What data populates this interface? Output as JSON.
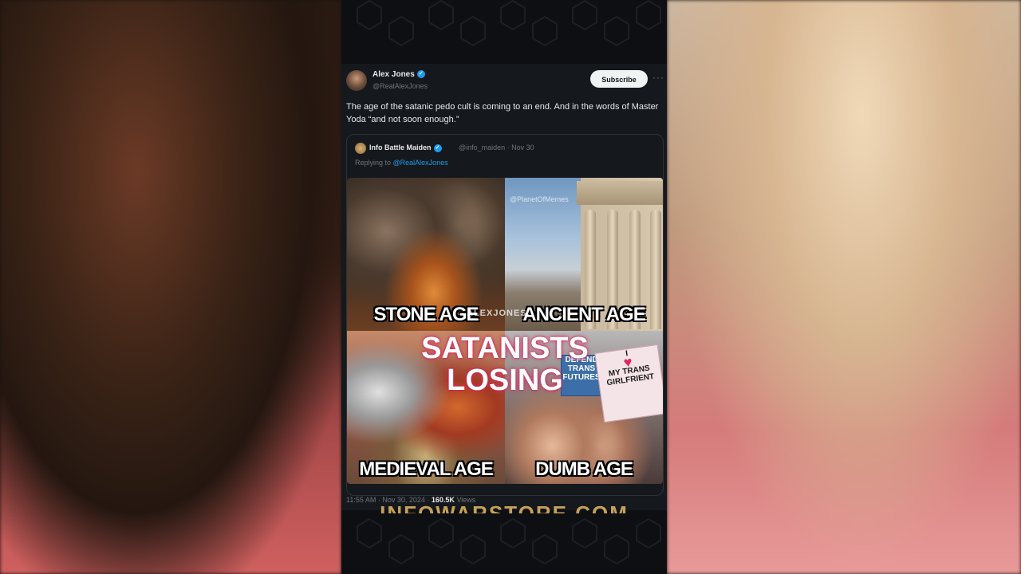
{
  "tweet": {
    "author_name": "Alex Jones",
    "author_handle": "@RealAlexJones",
    "subscribe_label": "Subscribe",
    "more_icon": "more-icon",
    "text": "The age of the satanic pedo cult is coming  to an end. And in the words of Master Yoda  “and not soon enough.”",
    "timestamp": "11:55 AM · Nov 30, 2024 · ",
    "views": "160.5K",
    "views_label": " Views"
  },
  "quote": {
    "author_name": "Info Battle Maiden",
    "author_handle": "@info_maiden · Nov 30",
    "replying_prefix": "Replying to ",
    "replying_to": "@RealAlexJones"
  },
  "meme": {
    "title_line1": "SATANISTS",
    "title_line2": "LOSING",
    "watermark_center": "ALEXJONES.",
    "watermark_corner": "@PlanetOfMemes",
    "panels": {
      "top_left": "STONE AGE",
      "top_right": "ANCIENT AGE",
      "bottom_left": "MEDIEVAL AGE",
      "bottom_right": "DUMB AGE"
    },
    "signs": {
      "trans": "DEFEND TRANS FUTURES",
      "love_prefix": "I",
      "love_text": "MY TRANS GIRLFRIENT"
    }
  },
  "bottom_banner": "INFOWARSTORE.COM",
  "colors": {
    "accent": "#1d9bf0",
    "background": "#15181c",
    "glow": "#e0245e"
  }
}
